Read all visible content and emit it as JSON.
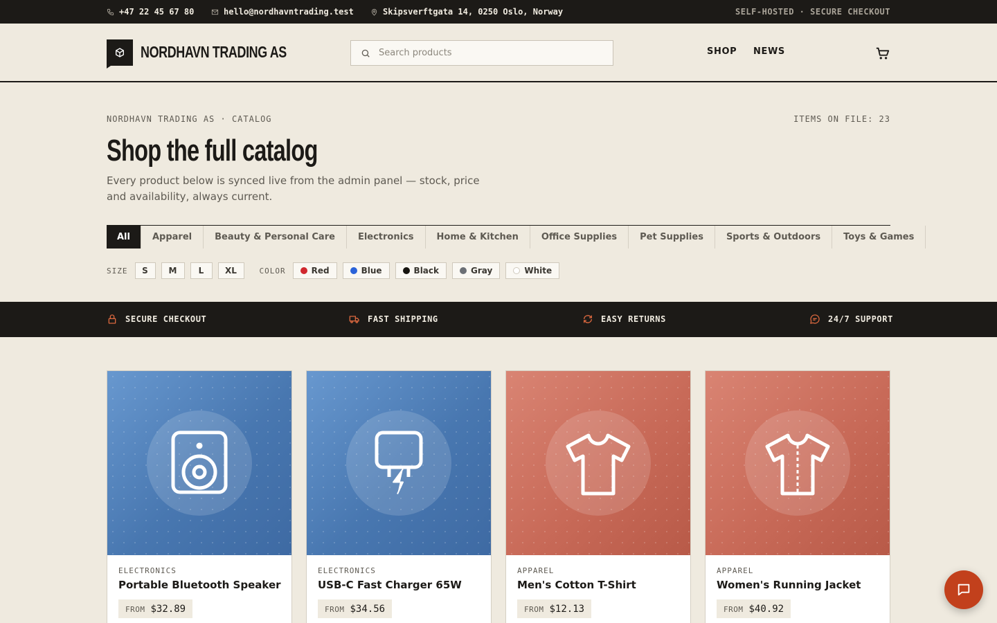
{
  "topbar": {
    "phone": "+47 22 45 67 80",
    "email": "hello@nordhavntrading.test",
    "address": "Skipsverftgata 14, 0250 Oslo, Norway",
    "tagline": "SELF-HOSTED · SECURE CHECKOUT"
  },
  "header": {
    "brand": "NORDHAVN TRADING AS",
    "search_placeholder": "Search products",
    "nav": [
      "SHOP",
      "NEWS"
    ]
  },
  "hero": {
    "eyebrow": "NORDHAVN TRADING AS · CATALOG",
    "items_on_file": "ITEMS ON FILE: 23",
    "title": "Shop the full catalog",
    "subtitle": "Every product below is synced live from the admin panel — stock, price and availability, always current."
  },
  "categories": [
    "All",
    "Apparel",
    "Beauty & Personal Care",
    "Electronics",
    "Home & Kitchen",
    "Office Supplies",
    "Pet Supplies",
    "Sports & Outdoors",
    "Toys & Games"
  ],
  "active_category": "All",
  "filters": {
    "size_label": "SIZE",
    "sizes": [
      "S",
      "M",
      "L",
      "XL"
    ],
    "color_label": "COLOR",
    "colors": [
      {
        "label": "Red",
        "hex": "#d0282e"
      },
      {
        "label": "Blue",
        "hex": "#2b63d9"
      },
      {
        "label": "Black",
        "hex": "#16140f"
      },
      {
        "label": "Gray",
        "hex": "#6b6f75"
      },
      {
        "label": "White",
        "hex": "#ffffff"
      }
    ]
  },
  "features": [
    "SECURE CHECKOUT",
    "FAST SHIPPING",
    "EASY RETURNS",
    "24/7 SUPPORT"
  ],
  "products": [
    {
      "category": "ELECTRONICS",
      "name": "Portable Bluetooth Speaker",
      "from": "FROM",
      "price": "$32.89",
      "icon": "speaker-icon",
      "tone": "blue"
    },
    {
      "category": "ELECTRONICS",
      "name": "USB-C Fast Charger 65W",
      "from": "FROM",
      "price": "$34.56",
      "icon": "charger-icon",
      "tone": "blue"
    },
    {
      "category": "APPAREL",
      "name": "Men's Cotton T-Shirt",
      "from": "FROM",
      "price": "$12.13",
      "icon": "tshirt-icon",
      "tone": "red"
    },
    {
      "category": "APPAREL",
      "name": "Women's Running Jacket",
      "from": "FROM",
      "price": "$40.92",
      "icon": "jacket-icon",
      "tone": "red"
    }
  ],
  "colors": {
    "dark": "#1c1a17",
    "background": "#efeadf",
    "accent": "#c2401c",
    "feature_icon": "#d9673e"
  }
}
